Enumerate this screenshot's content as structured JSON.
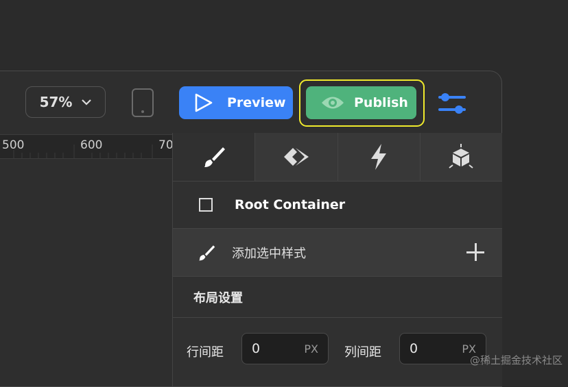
{
  "toolbar": {
    "zoom": "57%",
    "preview_label": "Preview",
    "publish_label": "Publish"
  },
  "ruler": {
    "ticks": [
      "500",
      "600",
      "70"
    ]
  },
  "inspector": {
    "tabs": [
      "brush-icon",
      "component-icon",
      "lightning-icon",
      "package-icon"
    ],
    "root_label": "Root Container",
    "add_style_label": "添加选中样式",
    "layout_section_label": "布局设置",
    "row_gap_label": "行间距",
    "row_gap_value": "0",
    "row_gap_unit": "PX",
    "col_gap_label": "列间距",
    "col_gap_value": "0",
    "col_gap_unit": "PX"
  },
  "watermark": "@稀土掘金技术社区",
  "colors": {
    "preview": "#3a82f6",
    "publish": "#4fb37c",
    "highlight": "#f0ea2c",
    "icon_blue": "#3a82f6"
  }
}
